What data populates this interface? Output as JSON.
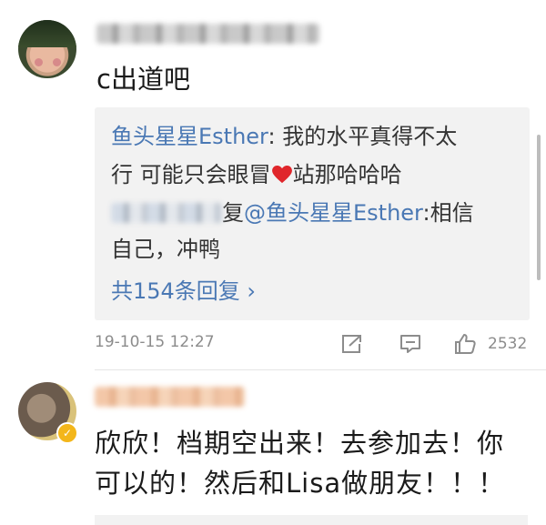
{
  "comments": [
    {
      "text": "c出道吧",
      "replies": {
        "r1": {
          "name": "鱼头星星Esther",
          "sep": ":",
          "line1": " 我的水平真得不太",
          "line2_before": "行 可能只会眼冒",
          "line2_after": "站那哈哈哈"
        },
        "r2": {
          "prefix": "复",
          "mention": "@鱼头星星Esther",
          "after": ":相信",
          "line2": "自己，冲鸭"
        },
        "more": "共154条回复 ›"
      },
      "timestamp": "19-10-15 12:27",
      "like_count": "2532"
    },
    {
      "line1": "欣欣！档期空出来！去参加去！你",
      "line2": "可以的！然后和Lisa做朋友！！！"
    }
  ],
  "colors": {
    "link": "#4a78b4",
    "heart": "#e0262b",
    "badge": "#f3b61a"
  },
  "icons": [
    "share-icon",
    "comment-icon",
    "like-icon",
    "heart-icon",
    "verified-badge-icon"
  ]
}
